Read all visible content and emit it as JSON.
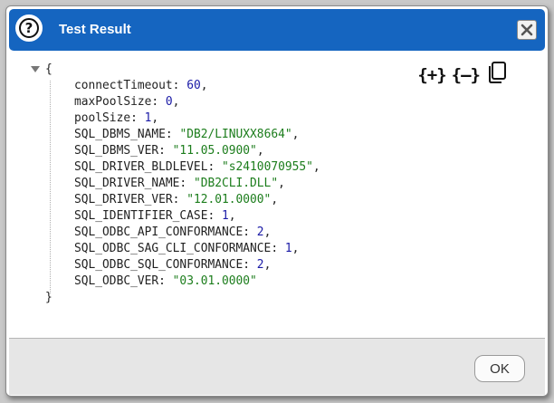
{
  "dialog": {
    "title": "Test Result",
    "help_icon_glyph": "?",
    "close_icon": "close-icon",
    "accent_color": "#1565c0"
  },
  "toolbar": {
    "expand_label": "{+}",
    "collapse_label": "{–}",
    "copy_icon": "copy-icon"
  },
  "json_view": {
    "open_brace": "{",
    "close_brace": "}",
    "entries": [
      {
        "key": "connectTimeout",
        "value": "60",
        "type": "number"
      },
      {
        "key": "maxPoolSize",
        "value": "0",
        "type": "number"
      },
      {
        "key": "poolSize",
        "value": "1",
        "type": "number"
      },
      {
        "key": "SQL_DBMS_NAME",
        "value": "\"DB2/LINUXX8664\"",
        "type": "string"
      },
      {
        "key": "SQL_DBMS_VER",
        "value": "\"11.05.0900\"",
        "type": "string"
      },
      {
        "key": "SQL_DRIVER_BLDLEVEL",
        "value": "\"s2410070955\"",
        "type": "string"
      },
      {
        "key": "SQL_DRIVER_NAME",
        "value": "\"DB2CLI.DLL\"",
        "type": "string"
      },
      {
        "key": "SQL_DRIVER_VER",
        "value": "\"12.01.0000\"",
        "type": "string"
      },
      {
        "key": "SQL_IDENTIFIER_CASE",
        "value": "1",
        "type": "number"
      },
      {
        "key": "SQL_ODBC_API_CONFORMANCE",
        "value": "2",
        "type": "number"
      },
      {
        "key": "SQL_ODBC_SAG_CLI_CONFORMANCE",
        "value": "1",
        "type": "number"
      },
      {
        "key": "SQL_ODBC_SQL_CONFORMANCE",
        "value": "2",
        "type": "number"
      },
      {
        "key": "SQL_ODBC_VER",
        "value": "\"03.01.0000\"",
        "type": "string"
      }
    ]
  },
  "footer": {
    "ok_label": "OK"
  }
}
